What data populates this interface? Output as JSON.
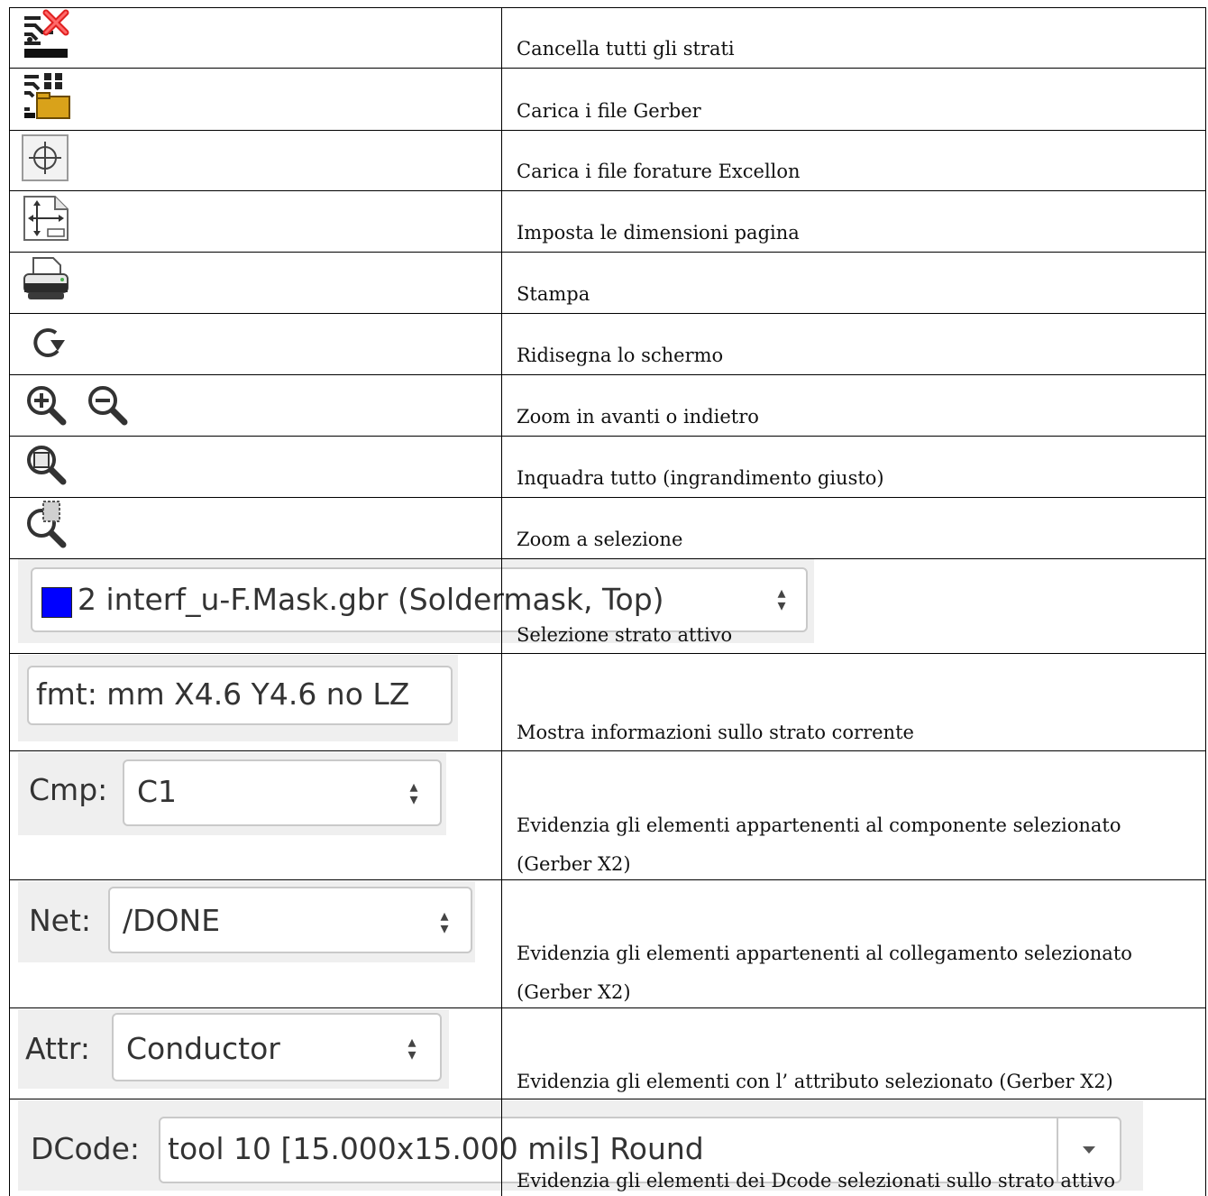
{
  "rows": [
    {
      "icon": "clear-layers-icon",
      "text": "Cancella tutti gli strati"
    },
    {
      "icon": "open-gerber-icon",
      "text": "Carica i file Gerber"
    },
    {
      "icon": "drill-target-icon",
      "text": "Carica i file forature Excellon"
    },
    {
      "icon": "page-size-icon",
      "text": "Imposta le dimensioni pagina"
    },
    {
      "icon": "printer-icon",
      "text": "Stampa"
    },
    {
      "icon": "redraw-icon",
      "text": "Ridisegna lo schermo"
    },
    {
      "icon": "zoom-in-out-icon",
      "text": "Zoom in avanti o indietro"
    },
    {
      "icon": "zoom-fit-icon",
      "text": "Inquadra tutto (ingrandimento giusto)"
    },
    {
      "icon": "zoom-selection-icon",
      "text": "Zoom a selezione"
    },
    {
      "icon": "layer-select-widget",
      "text": "Selezione strato attivo"
    },
    {
      "icon": "layer-info-widget",
      "text": "Mostra informazioni sullo strato corrente"
    },
    {
      "icon": "component-select-widget",
      "text": "Evidenzia gli elementi appartenenti al componente selezionato",
      "text2": "(Gerber X2)"
    },
    {
      "icon": "net-select-widget",
      "text": "Evidenzia gli elementi appartenenti al collegamento selezionato",
      "text2": "(Gerber X2)"
    },
    {
      "icon": "attribute-select-widget",
      "text": "Evidenzia gli elementi con l’ attributo selezionato (Gerber X2)"
    },
    {
      "icon": "dcode-select-widget",
      "text": "Evidenzia gli elementi dei Dcode selezionati sullo strato attivo"
    }
  ],
  "widgets": {
    "layer": {
      "value": "2 interf_u-F.Mask.gbr (Soldermask, Top)",
      "swatch_color": "#0000ff"
    },
    "info": {
      "value": "fmt: mm X4.6 Y4.6 no LZ"
    },
    "cmp": {
      "label": "Cmp:",
      "value": "C1"
    },
    "net": {
      "label": "Net:",
      "value": "/DONE"
    },
    "attr": {
      "label": "Attr:",
      "value": "Conductor"
    },
    "dcode": {
      "label": "DCode:",
      "value": "tool 10 [15.000x15.000 mils] Round"
    }
  }
}
